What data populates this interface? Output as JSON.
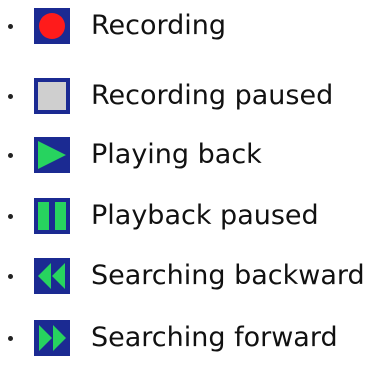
{
  "legend": {
    "items": [
      {
        "icon": "record-icon",
        "label": "Recording",
        "icon_color": "#ff1b1b"
      },
      {
        "icon": "record-paused-icon",
        "label": "Recording paused",
        "icon_color": "#cfcfcf"
      },
      {
        "icon": "play-icon",
        "label": "Playing back",
        "icon_color": "#27d35f"
      },
      {
        "icon": "pause-icon",
        "label": "Playback paused",
        "icon_color": "#27d35f"
      },
      {
        "icon": "rewind-icon",
        "label": "Searching backward",
        "icon_color": "#27d35f"
      },
      {
        "icon": "fast-forward-icon",
        "label": "Searching forward",
        "icon_color": "#27d35f"
      }
    ],
    "colors": {
      "icon_border": "#1b2a92",
      "bullet": "#222222",
      "text": "#111111"
    }
  }
}
